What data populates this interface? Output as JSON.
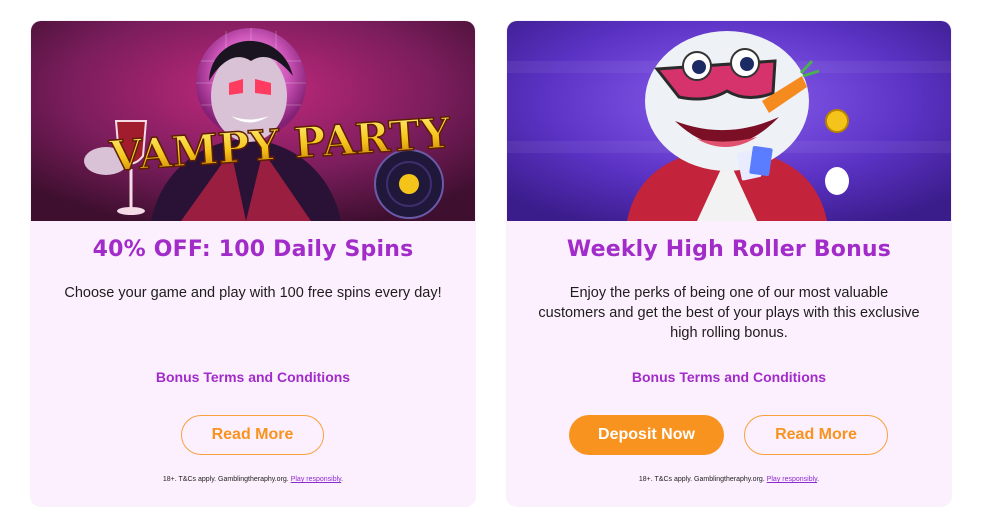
{
  "cards": [
    {
      "banner": {
        "game_logo": "VAMPY PARTY",
        "bg_color": "#6d1f54",
        "logo_color": "#f5d32a"
      },
      "title": "40% OFF: 100 Daily Spins",
      "description": "Choose your game and play with 100 free spins every day!",
      "terms_link": "Bonus Terms and Conditions",
      "buttons": {
        "read_more": "Read More"
      },
      "disclaimer": {
        "text": "18+. T&Cs apply. Gamblingtheraphy.org. ",
        "link": "Play responsibly",
        "period": "."
      }
    },
    {
      "banner": {
        "bg_color": "#5b32c4"
      },
      "title": "Weekly High Roller Bonus",
      "description": "Enjoy the perks of being one of our most valuable customers and get the best of your plays with this exclusive high rolling bonus.",
      "terms_link": "Bonus Terms and Conditions",
      "buttons": {
        "deposit": "Deposit Now",
        "read_more": "Read More"
      },
      "disclaimer": {
        "text": "18+. T&Cs apply. Gamblingtheraphy.org. ",
        "link": "Play responsibly",
        "period": "."
      }
    }
  ],
  "colors": {
    "title": "#a12cc9",
    "accent": "#f7931e",
    "card_bg": "#fdf0fe"
  }
}
